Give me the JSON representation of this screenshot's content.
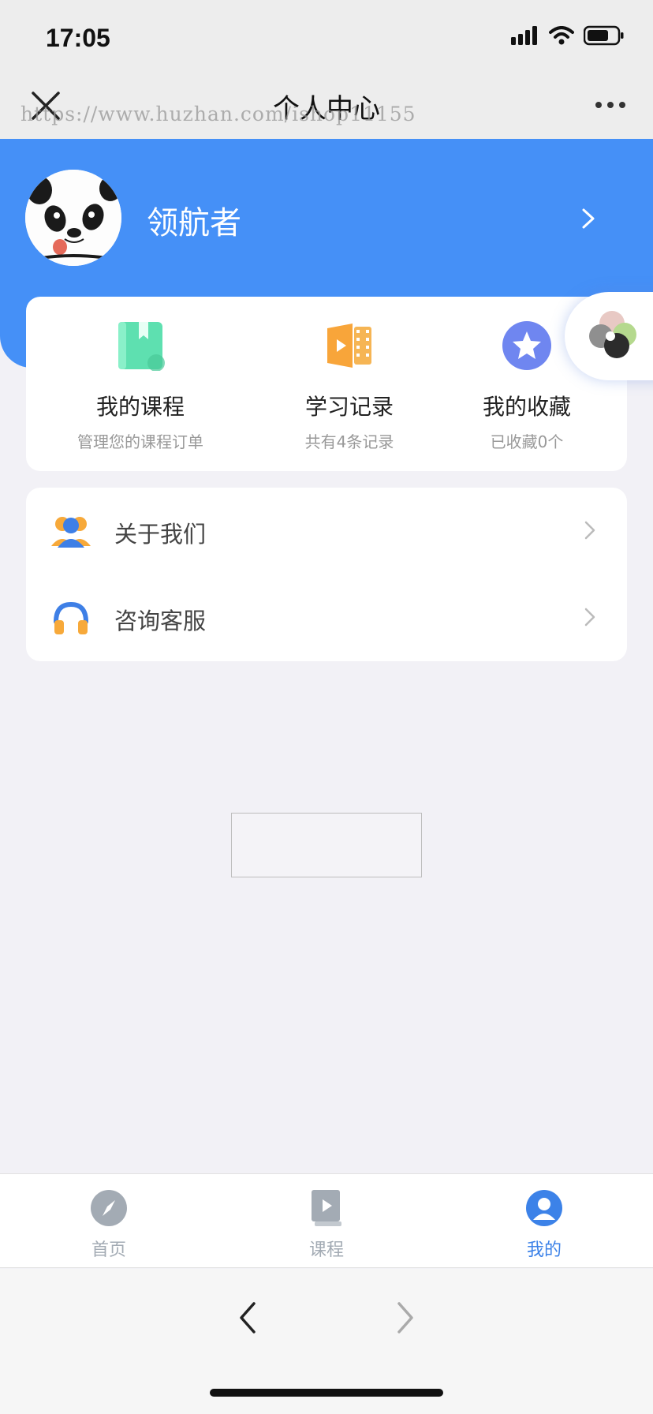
{
  "status_bar": {
    "time": "17:05"
  },
  "nav": {
    "title": "个人中心",
    "watermark": "https://www.huzhan.com/ishop11155"
  },
  "profile": {
    "username": "领航者"
  },
  "quick_actions": [
    {
      "label": "我的课程",
      "sub": "管理您的课程订单",
      "icon": "bookmark-book-icon",
      "color": "#5ee0b0"
    },
    {
      "label": "学习记录",
      "sub": "共有4条记录",
      "icon": "video-film-icon",
      "color": "#f8a53a"
    },
    {
      "label": "我的收藏",
      "sub": "已收藏0个",
      "icon": "star-icon",
      "color": "#6f86f0"
    }
  ],
  "menu": [
    {
      "label": "关于我们",
      "icon": "people-icon"
    },
    {
      "label": "咨询客服",
      "icon": "headphones-icon"
    }
  ],
  "tabs": [
    {
      "label": "首页",
      "icon": "compass-icon",
      "active": false
    },
    {
      "label": "课程",
      "icon": "course-book-icon",
      "active": false
    },
    {
      "label": "我的",
      "icon": "user-icon",
      "active": true
    }
  ],
  "colors": {
    "header_blue": "#4590f7",
    "active_tab": "#3c82e8",
    "inactive_tab": "#a3abb4"
  }
}
